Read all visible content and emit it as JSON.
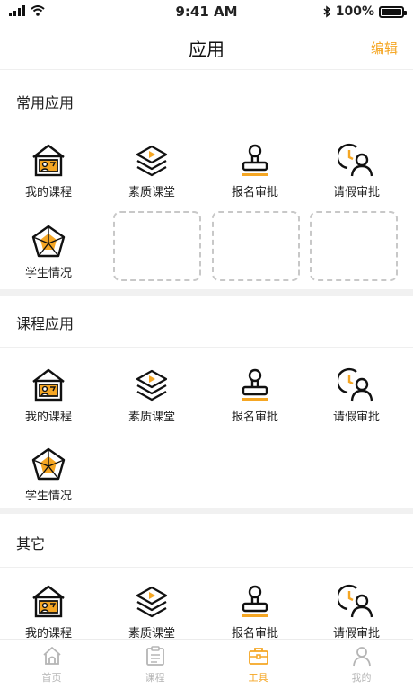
{
  "status_bar": {
    "time": "9:41 AM",
    "battery": "100%"
  },
  "nav": {
    "title": "应用",
    "edit_label": "编辑"
  },
  "sections": [
    {
      "title": "常用应用",
      "items": [
        {
          "label": "我的课程",
          "icon": "course-icon"
        },
        {
          "label": "素质课堂",
          "icon": "quality-class-icon"
        },
        {
          "label": "报名审批",
          "icon": "signup-approval-icon"
        },
        {
          "label": "请假审批",
          "icon": "leave-approval-icon"
        },
        {
          "label": "学生情况",
          "icon": "student-status-icon"
        }
      ]
    },
    {
      "title": "课程应用",
      "items": [
        {
          "label": "我的课程",
          "icon": "course-icon"
        },
        {
          "label": "素质课堂",
          "icon": "quality-class-icon"
        },
        {
          "label": "报名审批",
          "icon": "signup-approval-icon"
        },
        {
          "label": "请假审批",
          "icon": "leave-approval-icon"
        },
        {
          "label": "学生情况",
          "icon": "student-status-icon"
        }
      ]
    },
    {
      "title": "其它",
      "items": [
        {
          "label": "我的课程",
          "icon": "course-icon"
        },
        {
          "label": "素质课堂",
          "icon": "quality-class-icon"
        },
        {
          "label": "报名审批",
          "icon": "signup-approval-icon"
        },
        {
          "label": "请假审批",
          "icon": "leave-approval-icon"
        }
      ]
    }
  ],
  "tabs": [
    {
      "label": "首页",
      "icon": "home-icon",
      "active": false
    },
    {
      "label": "课程",
      "icon": "course-list-icon",
      "active": false
    },
    {
      "label": "工具",
      "icon": "toolbox-icon",
      "active": true
    },
    {
      "label": "我的",
      "icon": "profile-icon",
      "active": false
    }
  ],
  "colors": {
    "accent": "#f5a623",
    "text": "#222222",
    "inactive": "#b5b5b5",
    "divider": "#efefef"
  }
}
